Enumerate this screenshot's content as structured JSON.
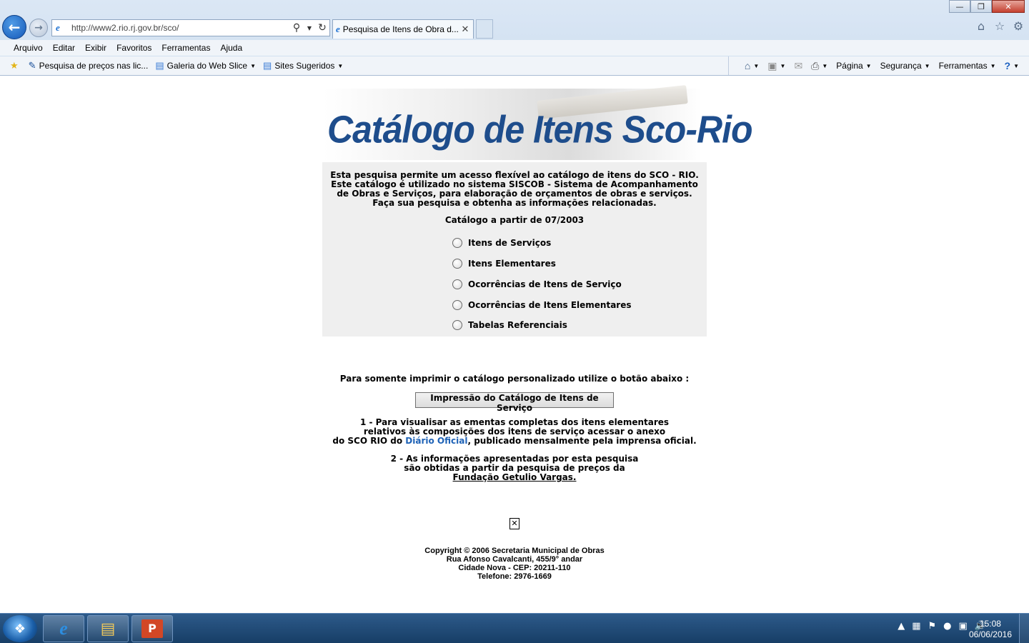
{
  "browser": {
    "address_url": "http://www2.rio.rj.gov.br/sco/",
    "tab_title": "Pesquisa de Itens de Obra d...",
    "menu": [
      "Arquivo",
      "Editar",
      "Exibir",
      "Favoritos",
      "Ferramentas",
      "Ajuda"
    ],
    "favorites": [
      "Pesquisa de preços nas lic...",
      "Galeria do Web Slice",
      "Sites Sugeridos"
    ],
    "commands": [
      "Página",
      "Segurança",
      "Ferramentas"
    ]
  },
  "page": {
    "banner_title": "Catálogo de Itens Sco-Rio",
    "intro_lines": [
      "Esta pesquisa permite um acesso flexível ao catálogo de itens do SCO - RIO.",
      "Este catálogo é utilizado no sistema SISCOB - Sistema de Acompanhamento",
      "de Obras e Serviços, para elaboração de orçamentos de obras e serviços.",
      "Faça sua pesquisa e obtenha as informações relacionadas."
    ],
    "since": "Catálogo a partir de 07/2003",
    "options": [
      "Itens de Serviços",
      "Itens Elementares",
      "Ocorrências de Itens de Serviço",
      "Ocorrências de Itens Elementares",
      "Tabelas Referenciais"
    ],
    "print_note": "Para somente imprimir o catálogo personalizado utilize o botão abaixo :",
    "print_button": "Impressão do Catálogo de Itens de Serviço",
    "note1": {
      "line1": "1 - Para visualisar as ementas completas dos itens elementares",
      "line2": "relativos às composições dos itens de serviço acessar o anexo",
      "line3_pre": "do SCO RIO do ",
      "link": "Diário Oficial",
      "line3_post": ", publicado mensalmente pela imprensa oficial."
    },
    "note2": {
      "line1": "2 - As informações apresentadas por esta pesquisa",
      "line2": "são obtidas a partir da pesquisa de preços da",
      "link": "Fundação Getulio Vargas."
    },
    "footer": [
      "Copyright © 2006 Secretaria Municipal de Obras",
      "Rua Afonso Cavalcanti, 455/9° andar",
      "Cidade Nova - CEP: 20211-110",
      "Telefone: 2976-1669"
    ]
  },
  "taskbar": {
    "time": "15:08",
    "date": "06/06/2016"
  }
}
